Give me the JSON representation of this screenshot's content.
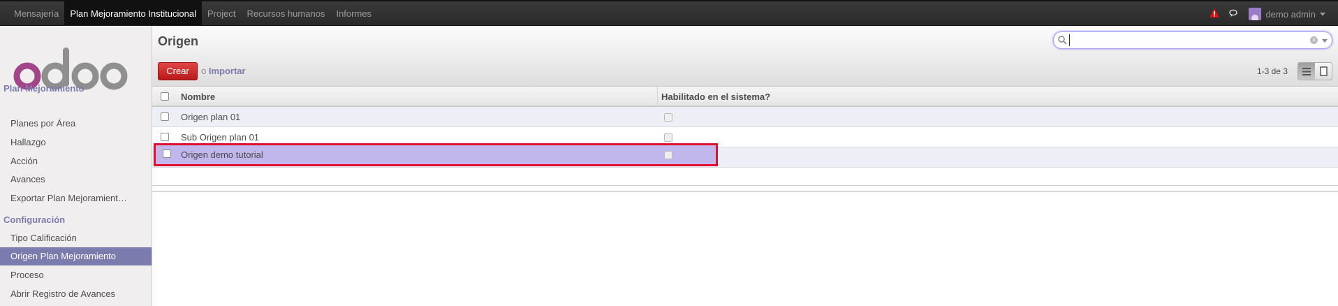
{
  "topbar": {
    "menu": [
      "Mensajería",
      "Plan Mejoramiento Institucional",
      "Project",
      "Recursos humanos",
      "Informes"
    ],
    "active_index": 1,
    "user": "demo  admin"
  },
  "sidebar": {
    "sections": [
      {
        "title": "Plan Mejoramiento",
        "items": [
          "Planes por Área",
          "Hallazgo",
          "Acción",
          "Avances",
          "Exportar Plan Mejoramient…"
        ]
      },
      {
        "title": "Configuración",
        "items": [
          "Tipo Calificación",
          "Origen Plan Mejoramiento",
          "Proceso",
          "Abrir Registro de Avances"
        ]
      }
    ],
    "active_item": "Origen Plan Mejoramiento"
  },
  "header": {
    "title": "Origen",
    "search_value": "",
    "create_label": "Crear",
    "or_label": "o",
    "import_label": "Importar",
    "pager": "1-3 de 3"
  },
  "table": {
    "columns": [
      "Nombre",
      "Habilitado en el sistema?"
    ],
    "rows": [
      {
        "name": "Origen plan 01",
        "enabled": true
      },
      {
        "name": "Sub Origen plan 01",
        "enabled": true
      },
      {
        "name": "Origen demo tutorial",
        "enabled": true
      }
    ]
  },
  "colors": {
    "accent": "#7c7bad",
    "create": "#c62828",
    "selected_row": "#c2b7ed",
    "highlight_border": "#e0102a"
  }
}
